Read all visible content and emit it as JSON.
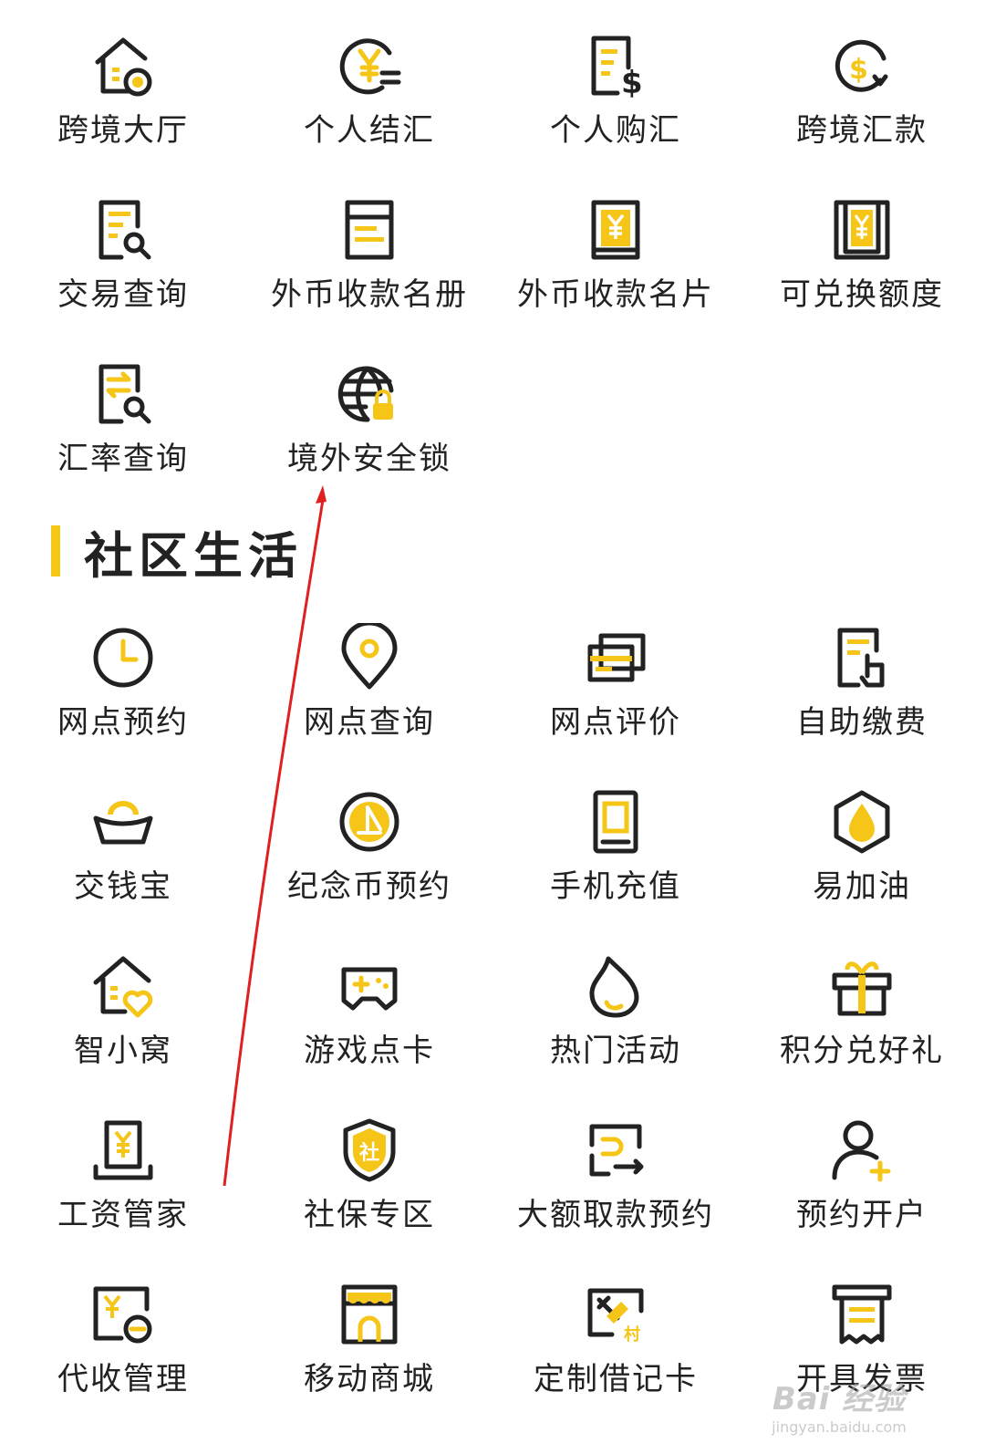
{
  "colors": {
    "accent": "#f5c518",
    "stroke": "#222222",
    "annotation_arrow": "#e02020"
  },
  "cross_border": {
    "items": [
      {
        "label": "跨境大厅",
        "icon": "house-coin-icon"
      },
      {
        "label": "个人结汇",
        "icon": "yen-exchange-icon"
      },
      {
        "label": "个人购汇",
        "icon": "document-dollar-icon"
      },
      {
        "label": "跨境汇款",
        "icon": "dollar-cycle-icon"
      },
      {
        "label": "交易查询",
        "icon": "document-search-icon"
      },
      {
        "label": "外币收款名册",
        "icon": "ledger-icon"
      },
      {
        "label": "外币收款名片",
        "icon": "yen-card-icon"
      },
      {
        "label": "可兑换额度",
        "icon": "yen-frame-icon"
      },
      {
        "label": "汇率查询",
        "icon": "exchange-rate-search-icon"
      },
      {
        "label": "境外安全锁",
        "icon": "globe-lock-icon"
      }
    ]
  },
  "community": {
    "title": "社区生活",
    "items": [
      {
        "label": "网点预约",
        "icon": "clock-icon"
      },
      {
        "label": "网点查询",
        "icon": "location-pin-icon"
      },
      {
        "label": "网点评价",
        "icon": "cards-icon"
      },
      {
        "label": "自助缴费",
        "icon": "document-hand-icon"
      },
      {
        "label": "交钱宝",
        "icon": "gold-ingot-icon"
      },
      {
        "label": "纪念币预约",
        "icon": "commemorative-coin-icon"
      },
      {
        "label": "手机充值",
        "icon": "phone-icon"
      },
      {
        "label": "易加油",
        "icon": "oil-drop-icon"
      },
      {
        "label": "智小窝",
        "icon": "house-heart-icon"
      },
      {
        "label": "游戏点卡",
        "icon": "gamepad-icon"
      },
      {
        "label": "热门活动",
        "icon": "flame-icon"
      },
      {
        "label": "积分兑好礼",
        "icon": "gift-icon"
      },
      {
        "label": "工资管家",
        "icon": "yen-monitor-icon"
      },
      {
        "label": "社保专区",
        "icon": "shield-icon"
      },
      {
        "label": "大额取款预约",
        "icon": "withdraw-icon"
      },
      {
        "label": "预约开户",
        "icon": "user-add-icon"
      },
      {
        "label": "代收管理",
        "icon": "yen-collect-icon"
      },
      {
        "label": "移动商城",
        "icon": "shop-icon"
      },
      {
        "label": "定制借记卡",
        "icon": "custom-card-icon"
      },
      {
        "label": "开具发票",
        "icon": "invoice-icon"
      }
    ]
  },
  "watermark": {
    "logo": "Bai 经验",
    "sub": "jingyan.baidu.com"
  }
}
